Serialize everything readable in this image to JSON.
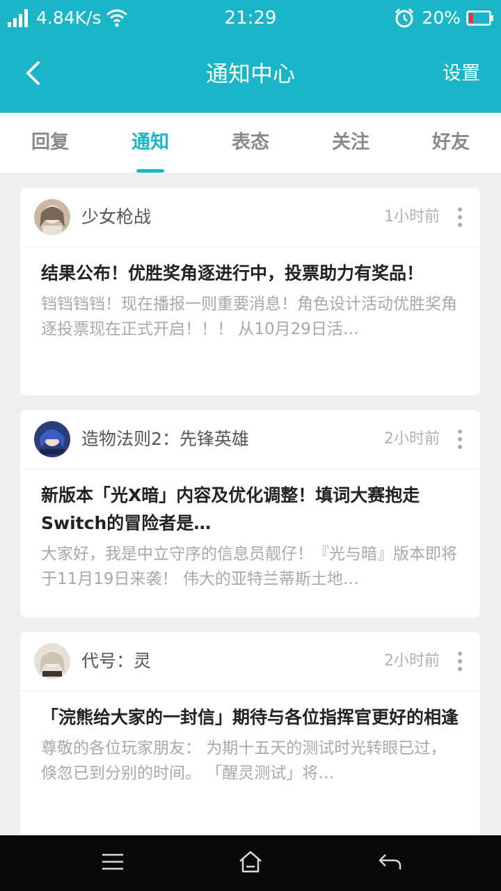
{
  "status_bar": {
    "net_speed": "4.84K/s",
    "time": "21:29",
    "battery": "20%"
  },
  "header": {
    "title": "通知中心",
    "settings_label": "设置"
  },
  "tabs": [
    {
      "label": "回复"
    },
    {
      "label": "通知"
    },
    {
      "label": "表态"
    },
    {
      "label": "关注"
    },
    {
      "label": "好友"
    }
  ],
  "active_tab": "通知",
  "notifications": [
    {
      "source": "少女枪战",
      "time": "1小时前",
      "title": "结果公布！优胜奖角逐进行中，投票助力有奖品！",
      "body": "铛铛铛铛！现在播报一则重要消息！角色设计活动优胜奖角逐投票现在正式开启！！！ 从10月29日活…"
    },
    {
      "source": "造物法则2：先锋英雄",
      "time": "2小时前",
      "title": "新版本「光X暗」内容及优化调整！填词大赛抱走Switch的冒险者是…",
      "body": "大家好，我是中立守序的信息员靓仔！『光与暗』版本即将于11月19日来袭！ 伟大的亚特兰蒂斯土地…"
    },
    {
      "source": "代号：灵",
      "time": "2小时前",
      "title": "「浣熊给大家的一封信」期待与各位指挥官更好的相逢",
      "body": "尊敬的各位玩家朋友： 为期十五天的测试时光转眼已过，倏忽已到分别的时间。 「醒灵测试」将…"
    }
  ],
  "colors": {
    "accent": "#1ab6c8",
    "background": "#efefef",
    "nav_bar": "#0a0a0a"
  }
}
